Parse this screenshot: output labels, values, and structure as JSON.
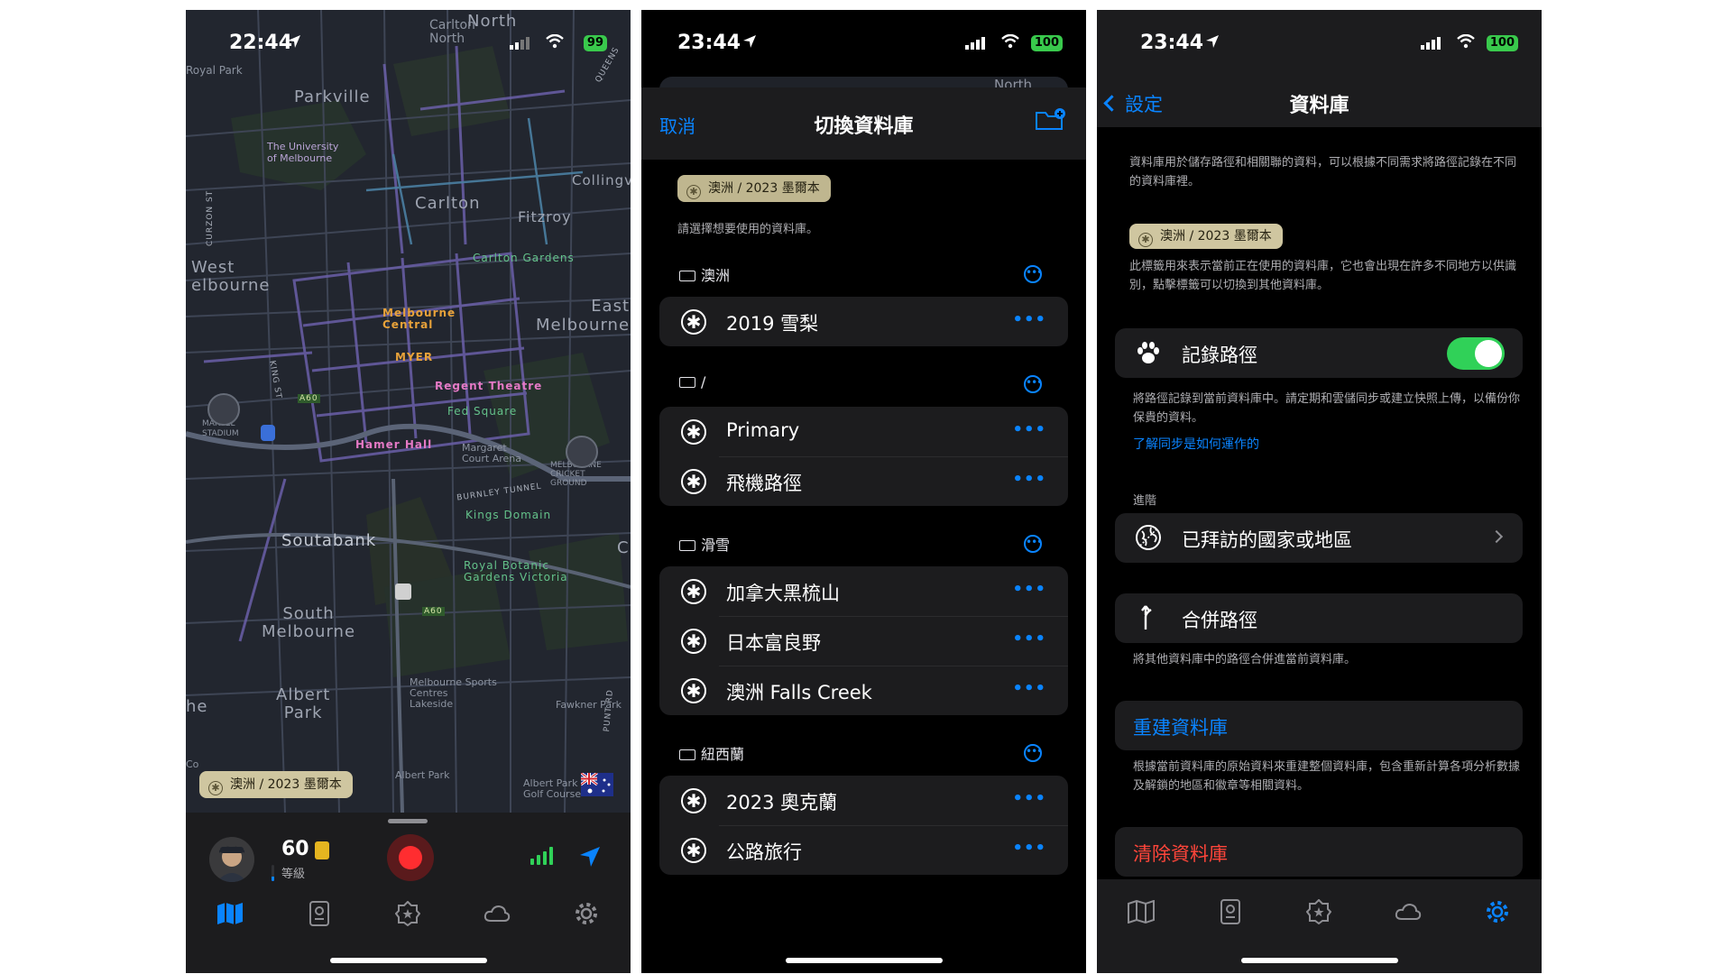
{
  "phone1": {
    "status": {
      "time": "22:44",
      "battery": "99"
    },
    "map_labels": {
      "north": "North",
      "carlton_north": "Carlton\nNorth",
      "royal_park": "Royal Park",
      "parkville": "Parkville",
      "university": "The University\nof Melbourne",
      "carlton": "Carlton",
      "collingwood": "Collingv",
      "fitzroy": "Fitzroy",
      "carlton_gardens": "Carlton Gardens",
      "west_melbourne": "West\nelbourne",
      "melbourne_central": "Melbourne\nCentral",
      "east_melbourne": "East\nMelbourne",
      "myer": "MYER",
      "regent_theatre": "Regent Theatre",
      "fed_square": "Fed Square",
      "marvel": "MARVEL\nSTADIUM",
      "hamer_hall": "Hamer Hall",
      "margaret_court": "Margaret\nCourt Arena",
      "mcg": "MELBOURNE\nCRICKET\nGROUND",
      "burnley": "BURNLEY TUNNEL",
      "kings_domain": "Kings Domain",
      "southbank": "Soutabank",
      "royal_botanic": "Royal Botanic\nGardens Victoria",
      "south_melbourne": "South\nMelbourne",
      "albert_park": "Albert\nPark",
      "msac": "Melbourne Sports\nCentres\nLakeside",
      "fawkner": "Fawkner Park",
      "albert_park_lake": "Albert Park",
      "albert_golf": "Albert Park\nGolf Course",
      "queens": "QUEENS",
      "curzon": "CURZON ST",
      "king": "KING ST",
      "punt": "PUNT RD",
      "a60": "A60",
      "he": "he",
      "c": "C",
      "co": "Co"
    },
    "db_chip": "澳洲 / 2023 墨爾本",
    "level": {
      "value": "60",
      "label": "等級",
      "progress": 0.3
    }
  },
  "phone2": {
    "status": {
      "time": "23:44",
      "battery": "100"
    },
    "map_peek_label": "North",
    "cancel": "取消",
    "title": "切換資料庫",
    "current_chip": "澳洲 / 2023 墨爾本",
    "hint": "請選擇想要使用的資料庫。",
    "sections": [
      {
        "folder": "澳洲",
        "items": [
          "2019 雪梨"
        ]
      },
      {
        "folder": "/",
        "items": [
          "Primary",
          "飛機路徑"
        ]
      },
      {
        "folder": "滑雪",
        "items": [
          "加拿大黑梳山",
          "日本富良野",
          "澳洲 Falls Creek"
        ]
      },
      {
        "folder": "紐西蘭",
        "items": [
          "2023 奧克蘭",
          "公路旅行"
        ]
      }
    ],
    "more": "•••"
  },
  "phone3": {
    "status": {
      "time": "23:44",
      "battery": "100"
    },
    "back": "設定",
    "title": "資料庫",
    "intro": "資料庫用於儲存路徑和相關聯的資料，可以根據不同需求將路徑記錄在不同的資料庫裡。",
    "chip": "澳洲 / 2023 墨爾本",
    "chip_desc": "此標籤用來表示當前正在使用的資料庫，它也會出現在許多不同地方以供識別，點擊標籤可以切換到其他資料庫。",
    "record": {
      "label": "記錄路徑",
      "on": true
    },
    "record_desc": "將路徑記錄到當前資料庫中。請定期和雲儲同步或建立快照上傳，以備份你保貴的資料。",
    "record_link": "了解同步是如何運作的",
    "advanced": "進階",
    "visited": "已拜訪的國家或地區",
    "merge": "合併路徑",
    "merge_desc": "將其他資料庫中的路徑合併進當前資料庫。",
    "rebuild": "重建資料庫",
    "rebuild_desc": "根據當前資料庫的原始資料來重建整個資料庫，包含重新計算各項分析數據及解鎖的地區和徽章等相關資料。",
    "clear": "清除資料庫"
  },
  "colors": {
    "accent": "#0a84ff",
    "toggle_on": "#30d158",
    "destructive": "#ff453a",
    "chip": "#cfc6a0",
    "record": "#ff2d30"
  },
  "icons": {
    "tabs": [
      "map-icon",
      "journal-icon",
      "badge-icon",
      "cloud-icon",
      "gear-icon"
    ],
    "record_path": "paw-icon",
    "visited": "globe-icon",
    "merge": "merge-arrow-icon"
  }
}
